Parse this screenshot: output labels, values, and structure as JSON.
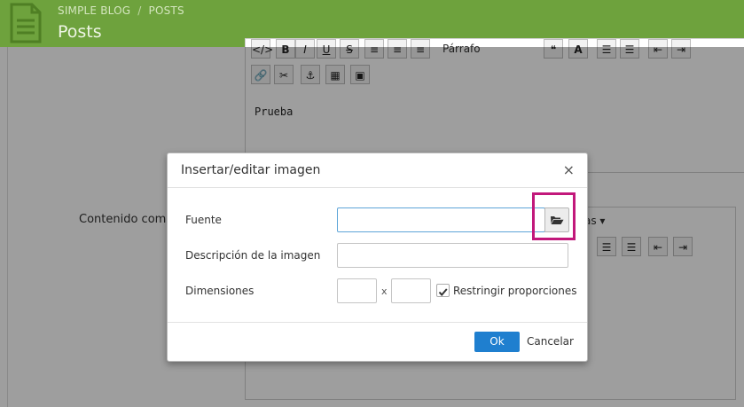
{
  "header": {
    "breadcrumb": [
      "SIMPLE BLOG",
      "POSTS"
    ],
    "breadcrumb_sep": "/",
    "title": "Posts"
  },
  "editor1": {
    "format_select": "Párrafo",
    "content": "Prueba"
  },
  "editor2": {
    "label": "Contenido comp",
    "select_fragment": "as"
  },
  "dialog": {
    "title": "Insertar/editar imagen",
    "close": "×",
    "fields": {
      "source_label": "Fuente",
      "source_value": "",
      "description_label": "Descripción de la imagen",
      "description_value": "",
      "dimensions_label": "Dimensiones",
      "width_value": "",
      "height_value": "",
      "times": "x",
      "constrain_label": "Restringir proporciones",
      "constrain_checked": true
    },
    "ok_label": "Ok",
    "cancel_label": "Cancelar"
  },
  "colors": {
    "header_green": "#6ea23d",
    "ok_blue": "#1f7fcf",
    "highlight": "#c2187b"
  }
}
